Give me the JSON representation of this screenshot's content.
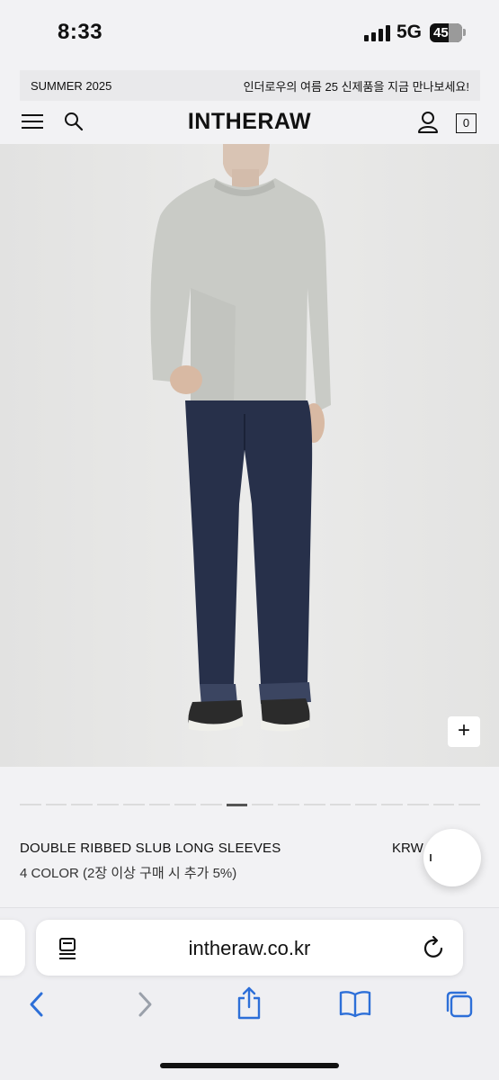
{
  "status_bar": {
    "time": "8:33",
    "network": "5G",
    "battery": "45"
  },
  "promo": {
    "left": "SUMMER 2025",
    "right": "인더로우의 여름 25 신제품을 지금 만나보세요!"
  },
  "header": {
    "logo": "INTHERAW",
    "cart_count": "0"
  },
  "hero": {
    "zoom_button": "+"
  },
  "carousel": {
    "total": 18,
    "active_index": 8
  },
  "product": {
    "name": "DOUBLE RIBBED SLUB LONG SLEEVES",
    "subtitle": "4 COLOR (2장 이상 구매 시 추가 5%)",
    "price_prefix": "KRW"
  },
  "browser": {
    "url": "intheraw.co.kr"
  },
  "icons": [
    "menu-icon",
    "search-icon",
    "user-icon",
    "cart-icon",
    "plus-icon",
    "reader-icon",
    "reload-icon",
    "back-icon",
    "forward-icon",
    "share-icon",
    "bookmarks-icon",
    "tabs-icon"
  ]
}
